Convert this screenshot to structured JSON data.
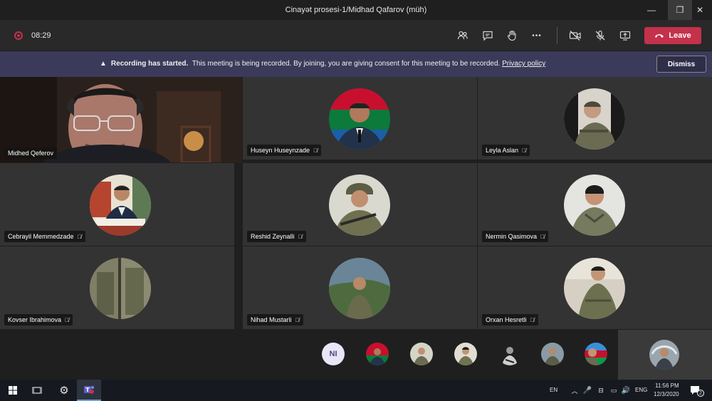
{
  "window": {
    "title": "Cinayət prosesi-1/Midhad Qafarov (müh)",
    "minimize": "—",
    "restore": "❐",
    "close": "✕"
  },
  "toolbar": {
    "timer": "08:29",
    "leave_label": "Leave",
    "more": "•••"
  },
  "banner": {
    "bold": "Recording has started.",
    "message": "This meeting is being recorded. By joining, you are giving consent for this meeting to be recorded.",
    "link": "Privacy policy",
    "dismiss_label": "Dismiss"
  },
  "participants": [
    {
      "name": "Midhed Qeferov",
      "video": true
    },
    {
      "name": "Huseyn Huseynzade"
    },
    {
      "name": "Leyla Aslan"
    },
    {
      "name": "Cebrayil Memmedzade"
    },
    {
      "name": "Reshid Zeynalli"
    },
    {
      "name": "Nermin Qasimova"
    },
    {
      "name": "Kovser Ibrahimova"
    },
    {
      "name": "Nihad Mustarli"
    },
    {
      "name": "Orxan Hesretli"
    }
  ],
  "strip": {
    "initials": "NI"
  },
  "taskbar": {
    "lang_en": "EN",
    "lang_eng": "ENG",
    "time": "11:56 PM",
    "date": "12/3/2020",
    "notif_count": "2"
  },
  "colors": {
    "leave": "#c4314b",
    "banner": "#3b3a5a",
    "tile": "#333333"
  }
}
